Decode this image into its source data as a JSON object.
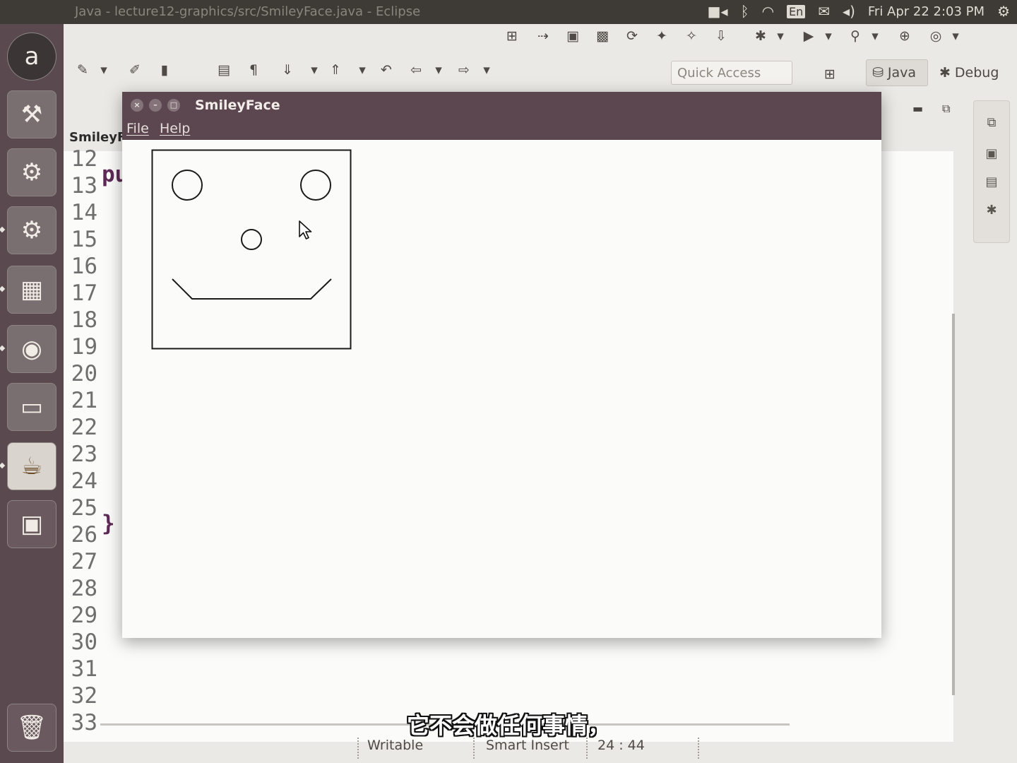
{
  "top_panel": {
    "window_title": "Java - lecture12-graphics/src/SmileyFace.java - Eclipse",
    "keyboard_layout": "En",
    "clock": "Fri Apr 22  2:03 PM",
    "icons": [
      "camera-icon",
      "bluetooth-icon",
      "wifi-icon",
      "mail-icon",
      "volume-icon",
      "gear-icon"
    ]
  },
  "launcher": {
    "items": [
      "ubuntu-logo",
      "system-settings",
      "software-updater",
      "settings-gear",
      "impress-presentation",
      "firefox",
      "workspace-switcher",
      "java",
      "window-manager",
      "trash"
    ]
  },
  "eclipse": {
    "quick_access_placeholder": "Quick Access",
    "perspectives": [
      {
        "label": "Java",
        "selected": true
      },
      {
        "label": "Debug",
        "selected": false
      }
    ],
    "editor_tab": "SmileyF",
    "line_numbers": [
      "12",
      "13",
      "14",
      "15",
      "16",
      "17",
      "18",
      "19",
      "20",
      "21",
      "22",
      "23",
      "24",
      "25",
      "26",
      "27",
      "28",
      "29",
      "30",
      "31",
      "32",
      "33"
    ],
    "code_fragments": {
      "line13": "pu",
      "line26": "}"
    },
    "status": {
      "writable": "Writable",
      "insert_mode": "Smart Insert",
      "position": "24 : 44"
    }
  },
  "smiley_window": {
    "title": "SmileyFace",
    "menu": {
      "file": "File",
      "help": "Help"
    }
  },
  "subtitle": "它不会做任何事情，",
  "colors": {
    "titlebar": "#5c4650",
    "launcher": "#5a4a50",
    "panel": "#3e3b37"
  }
}
